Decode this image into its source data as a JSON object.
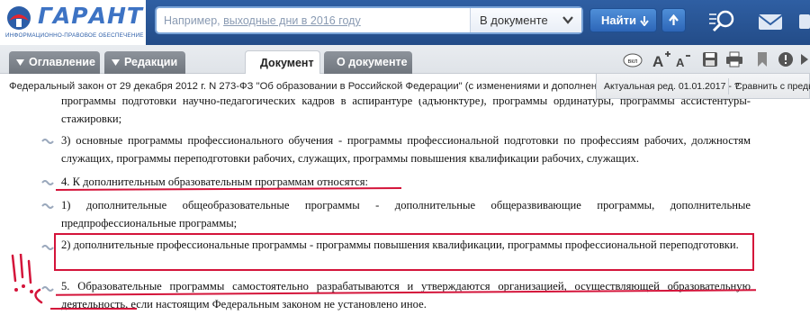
{
  "logo": {
    "word": "ГАРАНТ",
    "tagline": "ИНФОРМАЦИОННО-ПРАВОВОЕ ОБЕСПЕЧЕНИЕ"
  },
  "search": {
    "placeholder_prefix": "Например, ",
    "placeholder_example": "выходные дни в 2016 году",
    "scope": "В документе",
    "find_label": "Найти"
  },
  "tabs": {
    "contents": "Оглавление",
    "editions": "Редакции",
    "document": "Документ",
    "about": "О документе"
  },
  "toolbar": {
    "vkl": "вкл"
  },
  "doc_title": "Федеральный закон от 29 декабря 2012 г. N 273-ФЗ \"Об образовании в Российской Федерации\" (с изменениями и дополнениями)",
  "edition": {
    "label": "Актуальная ред. 01.01.2017 - ?",
    "compare": "Сравнить с предыд"
  },
  "paragraphs": [
    {
      "text": "программы подготовки научно-педагогических кадров в аспирантуре (адъюнктуре), программы ординатуры, программы ассистентуры-стажировки;"
    },
    {
      "text": "3) основные программы профессионального обучения - программы профессиональной подготовки по профессиям рабочих, должностям служащих, программы переподготовки рабочих, служащих, программы повышения квалификации рабочих, служащих."
    },
    {
      "text": "4. К дополнительным образовательным программам относятся:"
    },
    {
      "text": "1) дополнительные общеобразовательные программы - дополнительные общеразвивающие программы, дополнительные предпрофессиональные программы;"
    },
    {
      "text": "2) дополнительные профессиональные программы - программы повышения квалификации, программы профессиональной переподготовки."
    },
    {
      "text": "5. Образовательные программы самостоятельно разрабатываются и утверждаются организацией, осуществляющей образовательную деятельность, если настоящим Федеральным законом не установлено иное."
    }
  ],
  "colors": {
    "header_blue": "#2f5fa3",
    "highlight_red": "#d4143a",
    "tab_gray": "#7b8189"
  },
  "icons": [
    "garant-logo-icon",
    "chevron-down-icon",
    "arrow-down-icon",
    "arrow-up-icon",
    "magnifier-icon",
    "mail-icon",
    "font-increase-icon",
    "font-decrease-icon",
    "save-icon",
    "print-icon",
    "bookmark-icon",
    "warning-icon",
    "link-icon"
  ]
}
